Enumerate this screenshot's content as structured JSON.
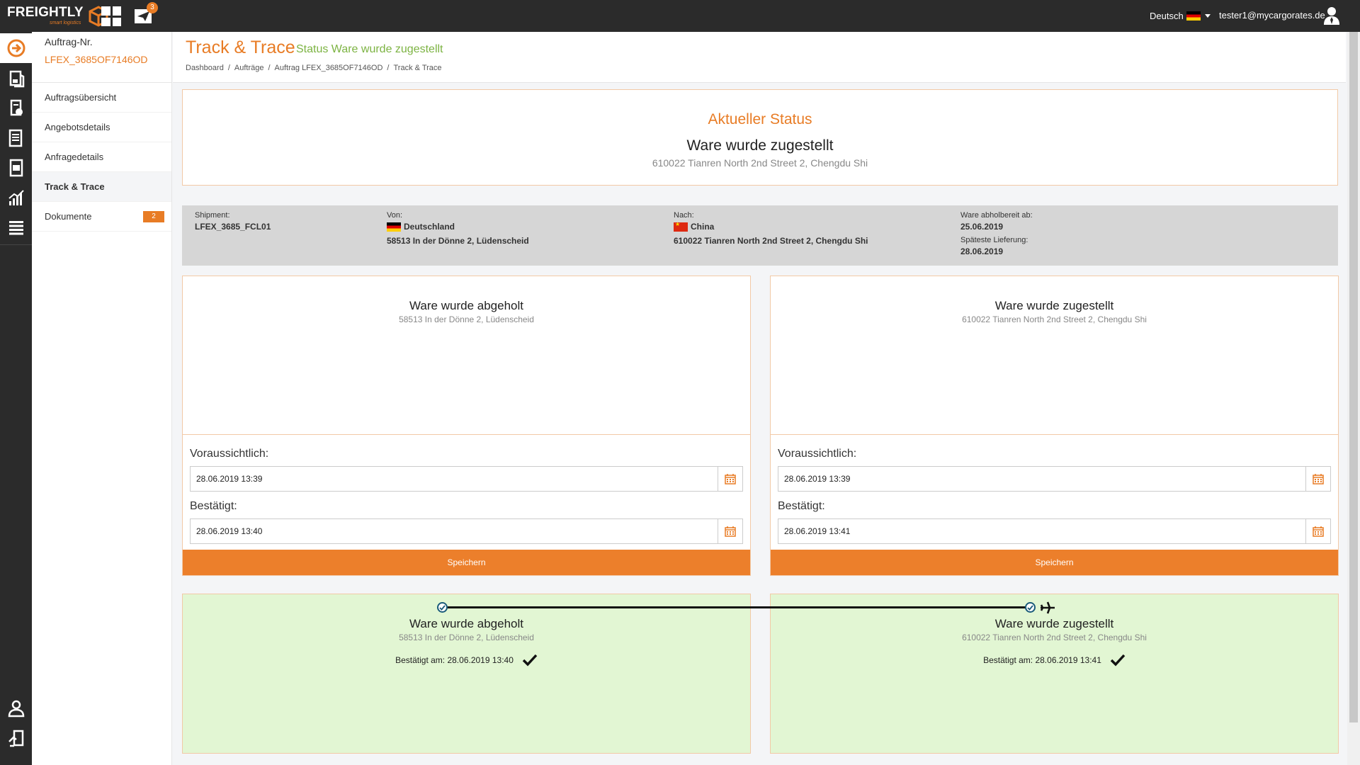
{
  "topbar": {
    "logo_main": "FREIGHTLY",
    "logo_sub": "smart logistics",
    "notification_count": "3",
    "language": "Deutsch",
    "user_email": "tester1@mycargorates.de"
  },
  "nav": {
    "order_label": "Auftrag-Nr.",
    "order_value": "LFEX_3685OF7146OD",
    "items": [
      {
        "label": "Auftragsübersicht"
      },
      {
        "label": "Angebotsdetails"
      },
      {
        "label": "Anfragedetails"
      },
      {
        "label": "Track & Trace"
      },
      {
        "label": "Dokumente",
        "badge": "2"
      }
    ]
  },
  "header": {
    "title": "Track & Trace",
    "subtitle": "Status Ware wurde zugestellt",
    "breadcrumb": [
      "Dashboard",
      "Aufträge",
      "Auftrag LFEX_3685OF7146OD",
      "Track & Trace"
    ]
  },
  "current_status": {
    "heading": "Aktueller Status",
    "status": "Ware wurde zugestellt",
    "address": "610022 Tianren North 2nd Street 2, Chengdu Shi"
  },
  "shipment": {
    "shipment_label": "Shipment:",
    "shipment_value": "LFEX_3685_FCL01",
    "from_label": "Von:",
    "from_country": "Deutschland",
    "from_address": "58513 In der Dönne 2, Lüdenscheid",
    "to_label": "Nach:",
    "to_country": "China",
    "to_address": "610022 Tianren North 2nd Street 2, Chengdu Shi",
    "ready_label": "Ware abholbereit ab:",
    "ready_value": "25.06.2019",
    "latest_label": "Späteste Lieferung:",
    "latest_value": "28.06.2019"
  },
  "cards": [
    {
      "title": "Ware wurde abgeholt",
      "address": "58513 In der Dönne 2, Lüdenscheid",
      "expected_label": "Voraussichtlich:",
      "expected_value": "28.06.2019 13:39",
      "confirmed_label": "Bestätigt:",
      "confirmed_value": "28.06.2019 13:40",
      "save_label": "Speichern"
    },
    {
      "title": "Ware wurde zugestellt",
      "address": "610022 Tianren North 2nd Street 2, Chengdu Shi",
      "expected_label": "Voraussichtlich:",
      "expected_value": "28.06.2019 13:39",
      "confirmed_label": "Bestätigt:",
      "confirmed_value": "28.06.2019 13:41",
      "save_label": "Speichern"
    }
  ],
  "timeline": [
    {
      "title": "Ware wurde abgeholt",
      "address": "58513 In der Dönne 2, Lüdenscheid",
      "confirmed": "Bestätigt am: 28.06.2019 13:40"
    },
    {
      "title": "Ware wurde zugestellt",
      "address": "610022 Tianren North 2nd Street 2, Chengdu Shi",
      "confirmed": "Bestätigt am: 28.06.2019 13:41"
    }
  ],
  "colors": {
    "accent": "#e87c25",
    "success_bg": "#e2f6d3",
    "subtitle_green": "#7cb342",
    "topbar": "#2b2b2b"
  }
}
